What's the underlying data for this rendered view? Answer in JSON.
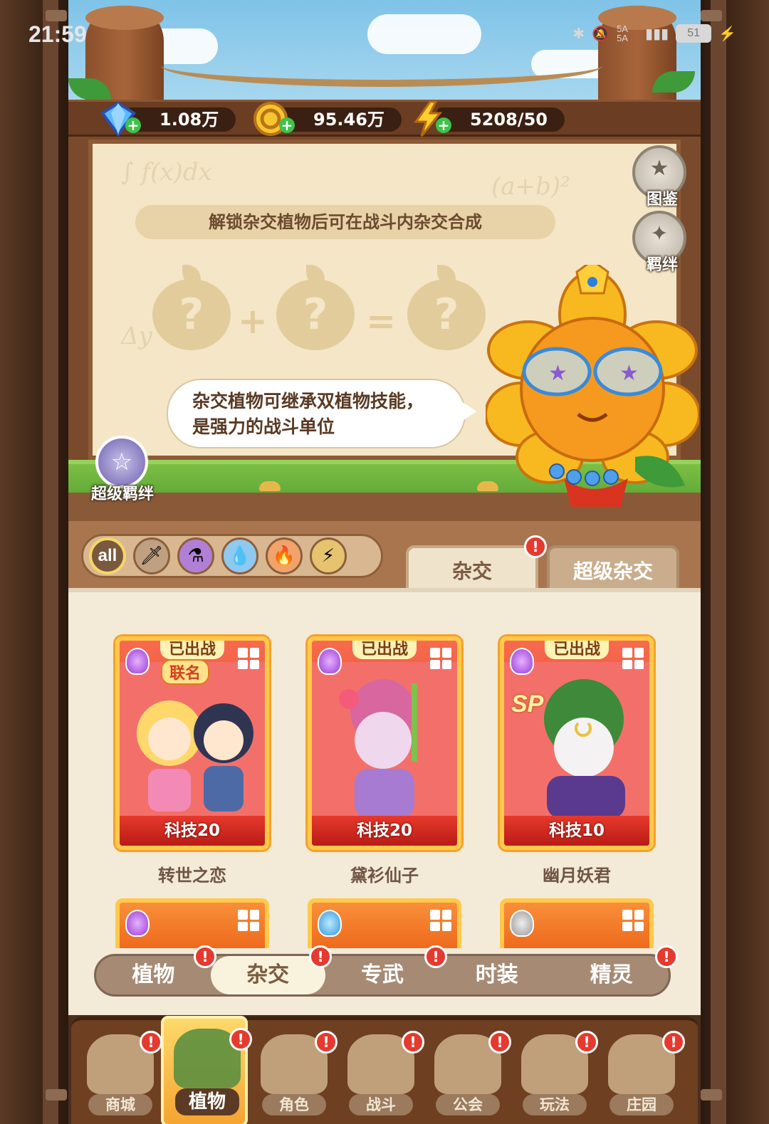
{
  "status_bar": {
    "time": "21:59",
    "signal": "5A 5A",
    "battery": "51"
  },
  "resources": [
    {
      "name": "diamond",
      "value": "1.08万"
    },
    {
      "name": "coin",
      "value": "95.46万"
    },
    {
      "name": "energy",
      "value": "5208/50"
    }
  ],
  "board": {
    "hint": "解锁杂交植物后可在战斗内杂交合成",
    "speech": "杂交植物可继承双植物技能，是强力的战斗单位",
    "slots": [
      "?",
      "?",
      "?"
    ],
    "plus": "+",
    "equals": "="
  },
  "side_buttons": {
    "codex": "图鉴",
    "bond": "羁绊"
  },
  "super_bond": "超级羁绊",
  "filters": [
    "all",
    "sword",
    "poison",
    "water",
    "fire",
    "lightning"
  ],
  "top_tabs": {
    "active": "杂交",
    "inactive": "超级杂交"
  },
  "cards": [
    {
      "status": "已出战",
      "tag": "联名",
      "level": "科技20",
      "name": "转世之恋",
      "type": "poison"
    },
    {
      "status": "已出战",
      "tag": "",
      "level": "科技20",
      "name": "黛衫仙子",
      "type": "poison"
    },
    {
      "status": "已出战",
      "tag": "SP",
      "level": "科技10",
      "name": "幽月妖君",
      "type": "poison"
    }
  ],
  "sub_tabs": [
    "植物",
    "杂交",
    "专武",
    "时装",
    "精灵"
  ],
  "sub_tab_active": 1,
  "bottom_nav": [
    "商城",
    "植物",
    "角色",
    "战斗",
    "公会",
    "玩法",
    "庄园"
  ],
  "bottom_nav_active": 1,
  "badge_mark": "!",
  "colors": {
    "accent_gold": "#ffc94a",
    "card_red": "#d8261f",
    "badge_red": "#e53a2f",
    "wood": "#6e3f21"
  }
}
